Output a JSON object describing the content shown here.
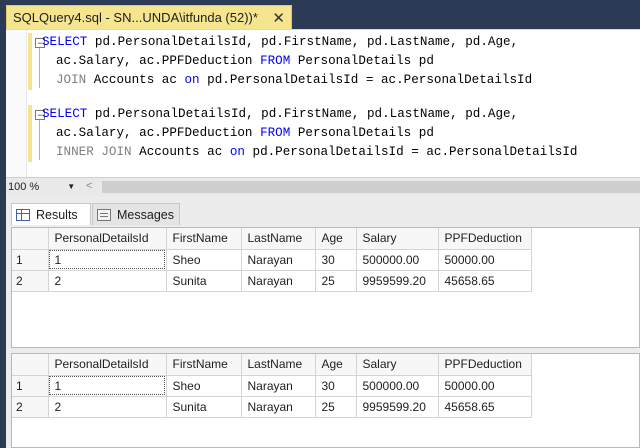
{
  "tab": {
    "title": "SQLQuery4.sql - SN...UNDA\\itfunda (52))*",
    "close": "✕"
  },
  "editor": {
    "q1": {
      "l1_kw1": "SELECT",
      "l1_rest": " pd.PersonalDetailsId, pd.FirstName, pd.LastName, pd.Age,",
      "l2_a": "ac.Salary, ac.PPFDeduction ",
      "l2_kw": "FROM",
      "l2_b": " PersonalDetails pd",
      "l3_join": "JOIN",
      "l3_a": " Accounts ac ",
      "l3_on": "on",
      "l3_b": " pd.PersonalDetailsId = ac.PersonalDetailsId"
    },
    "q2": {
      "l1_kw1": "SELECT",
      "l1_rest": " pd.PersonalDetailsId, pd.FirstName, pd.LastName, pd.Age,",
      "l2_a": "ac.Salary, ac.PPFDeduction ",
      "l2_kw": "FROM",
      "l2_b": " PersonalDetails pd",
      "l3_join": "INNER JOIN",
      "l3_a": " Accounts ac ",
      "l3_on": "on",
      "l3_b": " pd.PersonalDetailsId = ac.PersonalDetailsId"
    },
    "fold_symbol": "−"
  },
  "zoom": {
    "value": "100 %",
    "arrow": "▼",
    "scroll_left": "<"
  },
  "result_tabs": {
    "results": "Results",
    "messages": "Messages"
  },
  "grid1": {
    "columns": [
      "PersonalDetailsId",
      "FirstName",
      "LastName",
      "Age",
      "Salary",
      "PPFDeduction"
    ],
    "rows": [
      {
        "num": "1",
        "cells": [
          "1",
          "Sheo",
          "Narayan",
          "30",
          "500000.00",
          "50000.00"
        ]
      },
      {
        "num": "2",
        "cells": [
          "2",
          "Sunita",
          "Narayan",
          "25",
          "9959599.20",
          "45658.65"
        ]
      }
    ]
  },
  "grid2": {
    "columns": [
      "PersonalDetailsId",
      "FirstName",
      "LastName",
      "Age",
      "Salary",
      "PPFDeduction"
    ],
    "rows": [
      {
        "num": "1",
        "cells": [
          "1",
          "Sheo",
          "Narayan",
          "30",
          "500000.00",
          "50000.00"
        ]
      },
      {
        "num": "2",
        "cells": [
          "2",
          "Sunita",
          "Narayan",
          "25",
          "9959599.20",
          "45658.65"
        ]
      }
    ]
  },
  "colors": {
    "tab_active": "#f6e58f",
    "keyword": "#0000ff",
    "comment_gray": "#808080",
    "frame": "#2b3a55"
  }
}
